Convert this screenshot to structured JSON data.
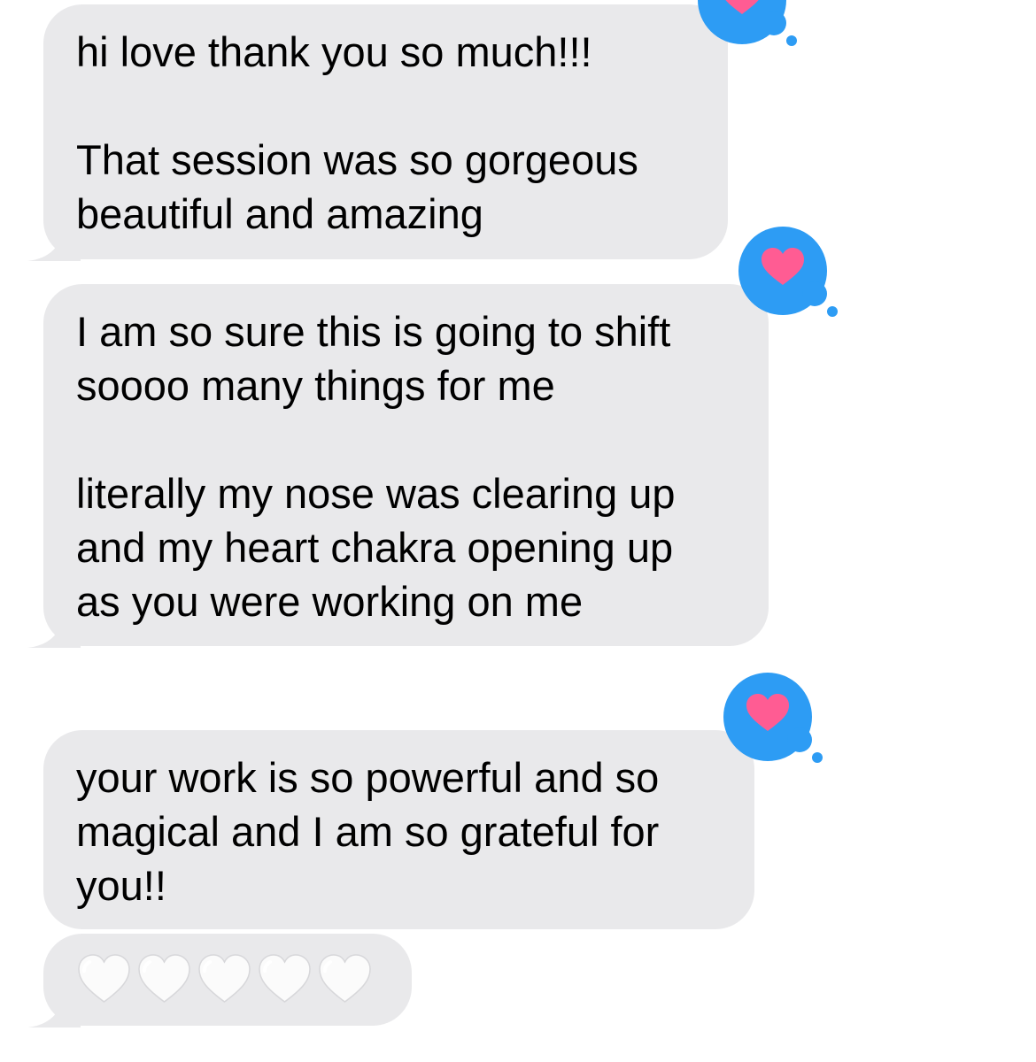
{
  "colors": {
    "bubble_bg": "#e9e9eb",
    "reaction_blue": "#2d9cf4",
    "reaction_heart": "#ff5c93",
    "white_heart": "#fbfbfb"
  },
  "messages": [
    {
      "text": "hi love thank you so much!!!\n\nThat session was so gorgeous\nbeautiful and amazing",
      "reaction": "heart-icon"
    },
    {
      "text": "I am so sure this is going to shift\nsoooo many things for me\n\nliterally my nose was clearing up\nand my heart chakra opening up\nas you were working on me",
      "reaction": "heart-icon"
    },
    {
      "text": "your work is so powerful and so\nmagical and I am so grateful for\nyou!!",
      "reaction": "heart-icon"
    },
    {
      "emoji": [
        "🤍",
        "🤍",
        "🤍",
        "🤍",
        "🤍"
      ],
      "emoji_icon": "white-heart-icon"
    }
  ]
}
